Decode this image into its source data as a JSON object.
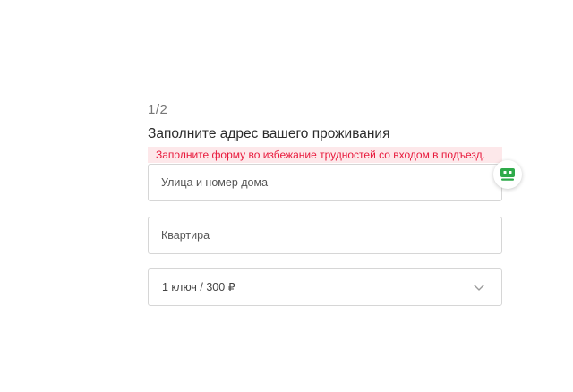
{
  "form": {
    "step": "1/2",
    "title": "Заполните адрес вашего проживания",
    "notice": "Заполните форму во избежание трудностей со входом в подъезд.",
    "street_placeholder": "Улица и номер дома",
    "street_value": "",
    "apartment_placeholder": "Квартира",
    "apartment_value": "",
    "key_select_value": "1 ключ / 300 ₽"
  },
  "icons": {
    "select_chevron": "chevron-down-icon",
    "helper": "robot-icon"
  },
  "colors": {
    "notice_text": "#e8193c",
    "notice_bg": "#fde8ea",
    "helper_accent": "#2eaa4a",
    "border": "#d6d6d6"
  }
}
